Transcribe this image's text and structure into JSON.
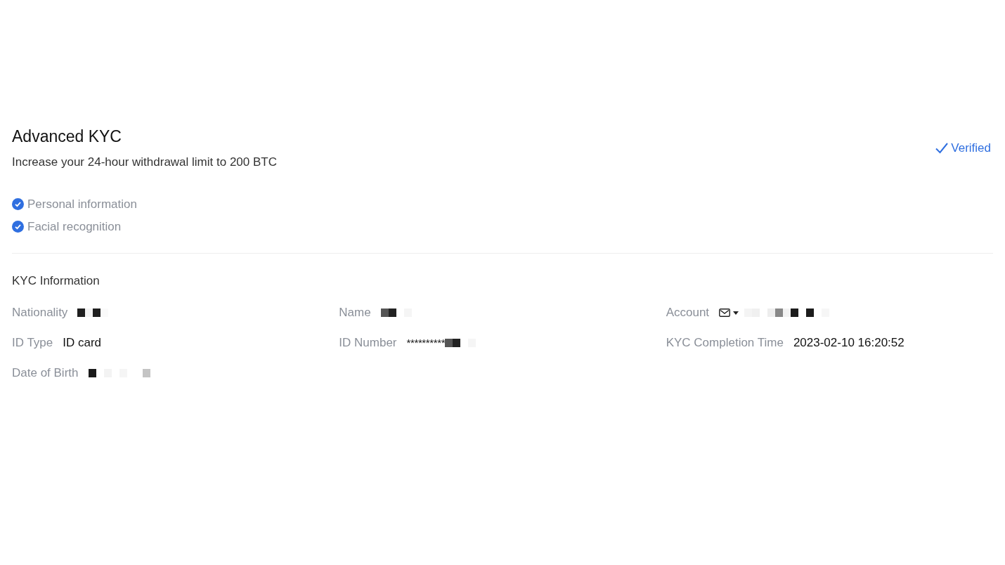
{
  "header": {
    "title": "Advanced KYC",
    "subtitle": "Increase your 24-hour withdrawal limit to 200 BTC",
    "status": {
      "label": "Verified",
      "verified": true
    }
  },
  "requirements": [
    {
      "label": "Personal information",
      "done": true
    },
    {
      "label": "Facial recognition",
      "done": true
    }
  ],
  "info": {
    "title": "KYC Information",
    "fields": [
      {
        "label": "Nationality",
        "kind": "redacted"
      },
      {
        "label": "Name",
        "kind": "redacted"
      },
      {
        "label": "Account",
        "kind": "email_redacted"
      },
      {
        "label": "ID Type",
        "kind": "text",
        "value": "ID card"
      },
      {
        "label": "ID Number",
        "kind": "masked",
        "value": "**********"
      },
      {
        "label": "KYC Completion Time",
        "kind": "text",
        "value": "2023-02-10 16:20:52"
      },
      {
        "label": "Date of Birth",
        "kind": "redacted"
      }
    ]
  }
}
